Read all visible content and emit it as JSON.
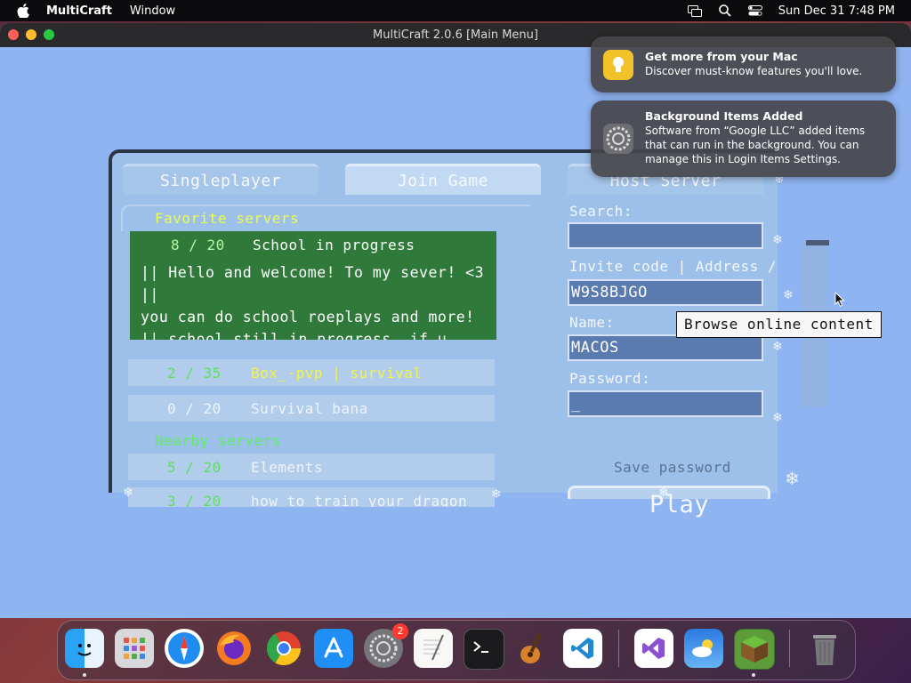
{
  "menubar": {
    "app_name": "MultiCraft",
    "menus": [
      "Window"
    ],
    "datetime": "Sun Dec 31  7:48 PM"
  },
  "window": {
    "title": "MultiCraft 2.0.6 [Main Menu]"
  },
  "game": {
    "tabs": [
      "Singleplayer",
      "Join Game",
      "Host Server"
    ],
    "active_tab": "Join Game",
    "favorite_label": "Favorite servers",
    "nearby_label": "Nearby servers",
    "selected_server": {
      "count": "8 / 20",
      "name": "School in progress",
      "description": "|| Hello and welcome! To my sever! <3 ||\nyou can do school roeplays and more!\n|| school still in progress, if u want\nask me if u wanna help. I might say yes"
    },
    "favorite_servers": [
      {
        "count": "2 / 35",
        "name": "Box_-pvp | survival"
      },
      {
        "count": "0 / 20",
        "name": "Survival bana"
      }
    ],
    "nearby_servers": [
      {
        "count": "5 / 20",
        "name": "Elements"
      },
      {
        "count": "3 / 20",
        "name": "how to train your dragon"
      }
    ],
    "search_label": "Search:",
    "search_value": "",
    "address_label": "Invite code | Address /",
    "address_value": "W9S8BJGO",
    "name_label": "Name:",
    "name_value": "MACOS",
    "password_label": "Password:",
    "password_value": "_",
    "save_password_label": "Save password",
    "play_label": "Play",
    "tooltip": "Browse online content"
  },
  "notifications": [
    {
      "title": "Get more from your Mac",
      "body": "Discover must-know features you'll love.",
      "icon": "lightbulb-icon"
    },
    {
      "title": "Background Items Added",
      "body": "Software from “Google LLC” added items that can run in the background. You can manage this in Login Items Settings.",
      "icon": "system-settings-icon"
    }
  ],
  "dock": {
    "items": [
      {
        "name": "Finder",
        "icon": "finder-icon"
      },
      {
        "name": "Launchpad",
        "icon": "launchpad-icon"
      },
      {
        "name": "Safari",
        "icon": "safari-icon"
      },
      {
        "name": "Firefox",
        "icon": "firefox-icon"
      },
      {
        "name": "Chrome",
        "icon": "chrome-icon"
      },
      {
        "name": "App Store",
        "icon": "app-store-icon"
      },
      {
        "name": "System Settings",
        "icon": "system-settings-icon",
        "badge": "2"
      },
      {
        "name": "TextEdit",
        "icon": "textedit-icon"
      },
      {
        "name": "Terminal",
        "icon": "terminal-icon"
      },
      {
        "name": "GarageBand",
        "icon": "garageband-icon"
      },
      {
        "name": "VS Code",
        "icon": "vscode-icon"
      },
      {
        "name": "Visual Studio",
        "icon": "visual-studio-icon"
      },
      {
        "name": "Weather",
        "icon": "weather-icon"
      },
      {
        "name": "MultiCraft",
        "icon": "multicraft-icon"
      },
      {
        "name": "Trash",
        "icon": "trash-icon"
      }
    ]
  },
  "colors": {
    "game_bg": "#8fb4f2",
    "selected_row": "#2f7a3a",
    "count_green": "#5ee05e",
    "label_yellow": "#ecfd4a"
  }
}
